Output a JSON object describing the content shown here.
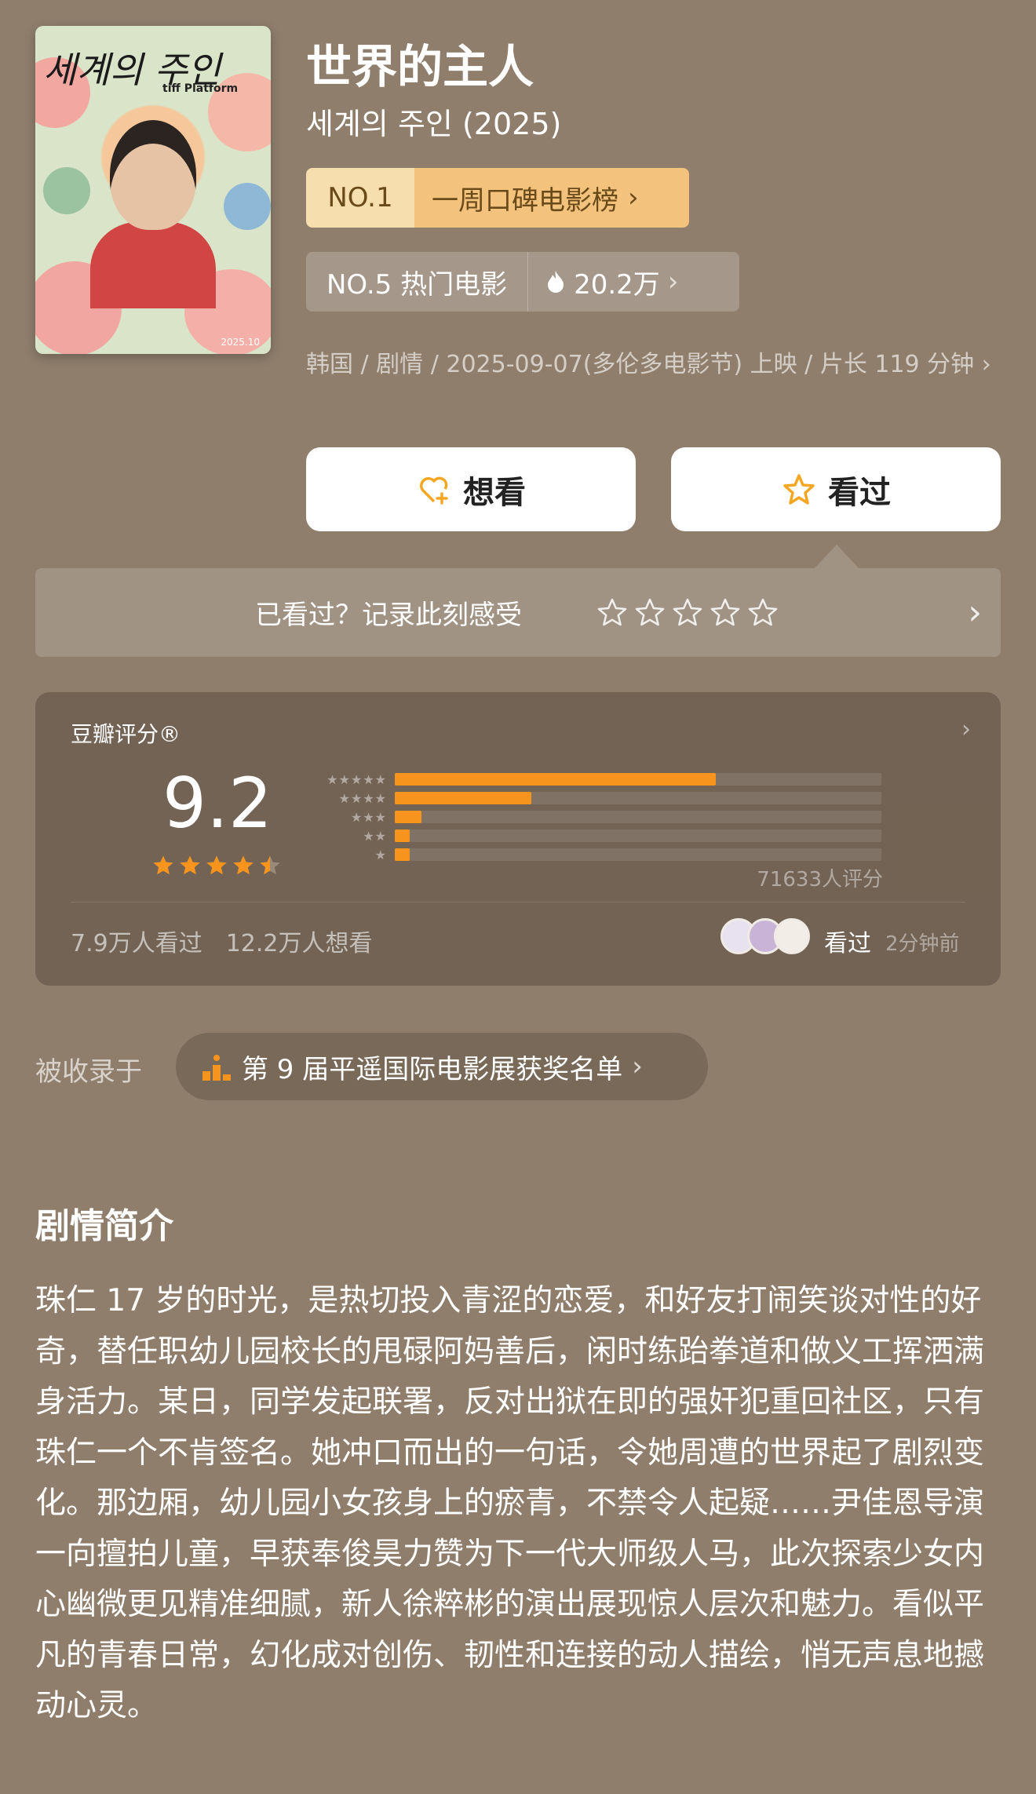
{
  "poster": {
    "title_text": "세계의 주인",
    "badge_text": "tiff Platform",
    "date_text": "2025.10"
  },
  "movie": {
    "title": "世界的主人",
    "subtitle": "세계의 주인 (2025)"
  },
  "rank_primary": {
    "no": "NO.1",
    "label": "一周口碑电影榜",
    "chevron": "›"
  },
  "rank_secondary": {
    "label": "NO.5 热门电影",
    "heat": "20.2万",
    "chevron": "›"
  },
  "meta": {
    "text": "韩国 / 剧情 / 2025-09-07(多伦多电影节) 上映 / 片长 119 分钟 ›"
  },
  "actions": {
    "want_label": "想看",
    "seen_label": "看过"
  },
  "record": {
    "prompt": "已看过？记录此刻感受",
    "star_count": 5,
    "chevron": "›"
  },
  "rating": {
    "label": "豆瓣评分®",
    "chevron": "›",
    "score": "9.2",
    "stars_value": 4.5,
    "distribution": [
      {
        "stars": "★★★★★",
        "ratio": 0.66
      },
      {
        "stars": "★★★★",
        "ratio": 0.28
      },
      {
        "stars": "★★★",
        "ratio": 0.055
      },
      {
        "stars": "★★",
        "ratio": 0.03
      },
      {
        "stars": "★",
        "ratio": 0.03
      }
    ],
    "count_text": "71633人评分",
    "watched_text": "7.9万人看过",
    "wish_text": "12.2万人想看",
    "seen_label": "看过",
    "seen_time": "2分钟前"
  },
  "collection": {
    "label": "被收录于",
    "name": "第 9 届平遥国际电影展获奖名单",
    "chevron": "›"
  },
  "synopsis": {
    "heading": "剧情简介",
    "body": "珠仁 17 岁的时光，是热切投入青涩的恋爱，和好友打闹笑谈对性的好奇，替任职幼儿园校长的甩碌阿妈善后，闲时练跆拳道和做义工挥洒满身活力。某日，同学发起联署，反对出狱在即的强奸犯重回社区，只有珠仁一个不肯签名。她冲口而出的一句话，令她周遭的世界起了剧烈变化。那边厢，幼儿园小女孩身上的瘀青，不禁令人起疑……尹佳恩导演一向擅拍儿童，早获奉俊昊力赞为下一代大师级人马，此次探索少女内心幽微更见精准细腻，新人徐粹彬的演出展现惊人层次和魅力。看似平凡的青春日常，幻化成对创伤、韧性和连接的动人描绘，悄无声息地撼动心灵。"
  },
  "colors": {
    "background": "#8f7e6c",
    "accent": "#f7941d",
    "rank_gold": "#f3c27c"
  }
}
